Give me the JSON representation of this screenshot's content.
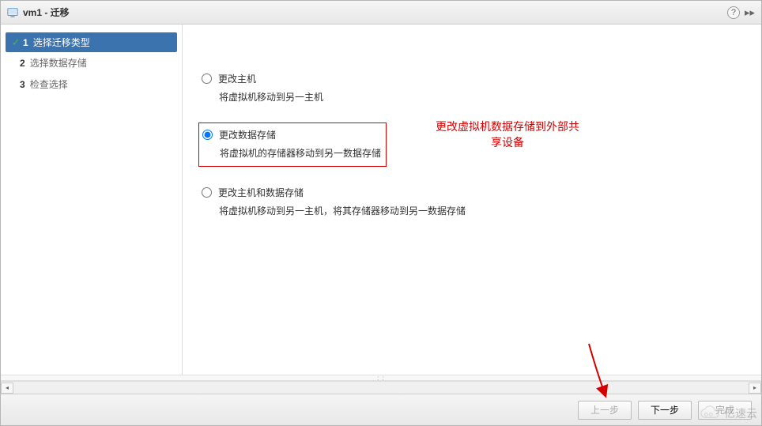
{
  "titlebar": {
    "title": "vm1 - 迁移",
    "help": "?",
    "expand": "▸▸"
  },
  "steps": [
    {
      "num": "1",
      "label": "选择迁移类型",
      "active": true,
      "complete": true
    },
    {
      "num": "2",
      "label": "选择数据存储",
      "active": false,
      "complete": false
    },
    {
      "num": "3",
      "label": "检查选择",
      "active": false,
      "complete": false
    }
  ],
  "options": [
    {
      "id": "opt-host",
      "title": "更改主机",
      "desc": "将虚拟机移动到另一主机",
      "selected": false,
      "highlighted": false
    },
    {
      "id": "opt-datastore",
      "title": "更改数据存储",
      "desc": "将虚拟机的存储器移动到另一数据存储",
      "selected": true,
      "highlighted": true
    },
    {
      "id": "opt-both",
      "title": "更改主机和数据存储",
      "desc": "将虚拟机移动到另一主机，将其存储器移动到另一数据存储",
      "selected": false,
      "highlighted": false
    }
  ],
  "annotation": "更改虚拟机数据存储到外部共\n享设备",
  "footer": {
    "back": "上一步",
    "next": "下一步",
    "finish": "完成"
  },
  "watermark": "亿速云"
}
